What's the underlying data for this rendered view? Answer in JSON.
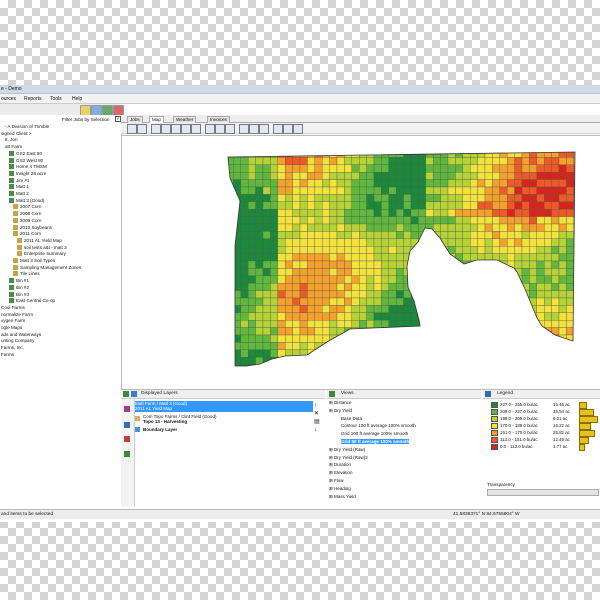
{
  "window": {
    "title": "e - Demo"
  },
  "menu": [
    "ources",
    "Reports",
    "Tools",
    "Help"
  ],
  "tree": {
    "filter_label": "Filter Jobs by Selection",
    "items": [
      {
        "label": "- A Division of Trimble",
        "indent": 1
      },
      {
        "label": "signed Client >",
        "indent": 0
      },
      {
        "label": "tt, Jon",
        "indent": 1
      },
      {
        "label": "att Farm",
        "indent": 1
      },
      {
        "label": "GS2 East 80",
        "indent": 2
      },
      {
        "label": "GS2 West 80",
        "indent": 2
      },
      {
        "label": "Home 4 TMSM",
        "indent": 2
      },
      {
        "label": "Insight 28 acre",
        "indent": 2
      },
      {
        "label": "Jim #1",
        "indent": 2
      },
      {
        "label": "Matt 1",
        "indent": 2
      },
      {
        "label": "Matt 2",
        "indent": 2
      },
      {
        "label": "Matt 3 (Good)",
        "indent": 2
      },
      {
        "label": "2007 Corn",
        "indent": 3
      },
      {
        "label": "2008 Corn",
        "indent": 3
      },
      {
        "label": "2009 Corn",
        "indent": 3
      },
      {
        "label": "2010 Soybeans",
        "indent": 3
      },
      {
        "label": "2011 Corn",
        "indent": 3
      },
      {
        "label": "2011 AL Yield Map",
        "indent": 4
      },
      {
        "label": "soil tests a&l - matt 3",
        "indent": 4
      },
      {
        "label": "Enterprise Summary",
        "indent": 4
      },
      {
        "label": "Matt 3 Soil Types",
        "indent": 3
      },
      {
        "label": "Sampling Management Zones",
        "indent": 3
      },
      {
        "label": "Tile Lines",
        "indent": 3
      },
      {
        "label": "Bin #1",
        "indent": 2
      },
      {
        "label": "Bin #2",
        "indent": 2
      },
      {
        "label": "Bin #3",
        "indent": 2
      },
      {
        "label": "East Central Co-op",
        "indent": 2
      },
      {
        "label": "Cool Farms",
        "indent": 0
      },
      {
        "label": "normalize Farm",
        "indent": 0
      },
      {
        "label": "vygen Farm",
        "indent": 0
      },
      {
        "label": "ogle Maps",
        "indent": 0
      },
      {
        "label": "ads and Waterways",
        "indent": 0
      },
      {
        "label": "unting Company",
        "indent": 0
      },
      {
        "label": "Farms, Inc.",
        "indent": 0
      },
      {
        "label": "Farms",
        "indent": 0
      }
    ]
  },
  "tabs": [
    "Jobs",
    "Map",
    "Weather",
    "Invoices"
  ],
  "layers": {
    "title": "Displayed Layers",
    "items": [
      {
        "line1": "Matt Farm / Matt 3 (Good)",
        "line2": "2011 AL Yield Map",
        "selected": true
      },
      {
        "line1": "Com Topo Farms / Clint Field (Good)",
        "line2": "Topo 13 - Harvesting",
        "selected": false
      },
      {
        "line1": "Boundary Layer",
        "line2": "",
        "selected": false
      }
    ]
  },
  "views": {
    "title": "Views",
    "items": [
      {
        "label": "Distance",
        "indent": 0
      },
      {
        "label": "Dry Yield",
        "indent": 0
      },
      {
        "label": "Base Data",
        "indent": 1
      },
      {
        "label": "Contour 100 ft average 100% smooth",
        "indent": 1
      },
      {
        "label": "Grid 100 ft average 100% smooth",
        "indent": 1
      },
      {
        "label": "Grid 50 ft average 100% smooth",
        "indent": 1,
        "selected": true
      },
      {
        "label": "Dry Yield (Raw)",
        "indent": 0
      },
      {
        "label": "Dry Yield (Raw)2",
        "indent": 0
      },
      {
        "label": "Duration",
        "indent": 0
      },
      {
        "label": "Elevation",
        "indent": 0
      },
      {
        "label": "Flow",
        "indent": 0
      },
      {
        "label": "Heading",
        "indent": 0
      },
      {
        "label": "Mass Yield",
        "indent": 0
      }
    ]
  },
  "legend": {
    "title": "Legend",
    "rows": [
      {
        "range": "227.0 - 255.0 bu/ac",
        "acres": "15.46 ac",
        "color": "#1a8a3a"
      },
      {
        "range": "209.0 - 227.0 bu/ac",
        "acres": "35.54 ac",
        "color": "#5fb83c"
      },
      {
        "range": "189.0 - 209.0 bu/ac",
        "acres": "6.01 ac",
        "color": "#b5d334"
      },
      {
        "range": "170.0 - 189.0 bu/ac",
        "acres": "16.22 ac",
        "color": "#f2e23a"
      },
      {
        "range": "151.0 - 170.0 bu/ac",
        "acres": "25.82 ac",
        "color": "#f6a02c"
      },
      {
        "range": "113.0 - 151.0 bu/ac",
        "acres": "12.49 ac",
        "color": "#ee5a26"
      },
      {
        "range": "0.0 - 113.0 bu/ac",
        "acres": "1.77 ac",
        "color": "#d9241c"
      }
    ],
    "transparency_label": "Transparency",
    "histogram": [
      0.35,
      0.7,
      0.95,
      0.55,
      0.8,
      0.45,
      0.2
    ]
  },
  "status": {
    "left": "and items to be selected",
    "coords": "41.5838371° N  84.6755804° W"
  }
}
